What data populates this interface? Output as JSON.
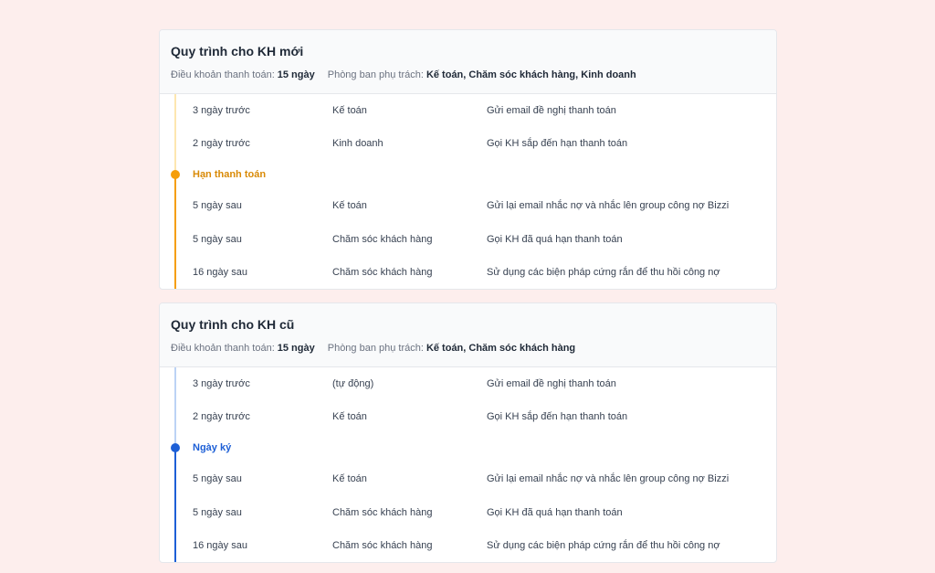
{
  "colors": {
    "background": "#fdeeed",
    "accent_orange": "#f59e0b",
    "accent_orange_light": "#fde7b0",
    "accent_blue": "#1d5fd6",
    "accent_blue_light": "#bcd3f5"
  },
  "cards": [
    {
      "title": "Quy trình cho KH mới",
      "terms_label": "Điều khoản thanh toán:",
      "terms_value": "15 ngày",
      "dept_label": "Phòng ban phụ trách:",
      "dept_value": "Kế toán, Chăm sóc khách hàng, Kinh doanh",
      "before": [
        {
          "time": "3 ngày trước",
          "dept": "Kế toán",
          "action": "Gửi email đề nghị thanh toán"
        },
        {
          "time": "2 ngày trước",
          "dept": "Kinh doanh",
          "action": "Gọi KH sắp đến hạn thanh toán"
        }
      ],
      "milestone": "Hạn thanh toán",
      "after": [
        {
          "time": "5 ngày sau",
          "dept": "Kế toán",
          "action": "Gửi lại email nhắc nợ và nhắc lên group công nợ Bizzi"
        },
        {
          "time": "5 ngày sau",
          "dept": "Chăm sóc khách hàng",
          "action": "Gọi KH đã quá hạn thanh toán"
        },
        {
          "time": "16 ngày sau",
          "dept": "Chăm sóc khách hàng",
          "action": "Sử dụng các biện pháp cứng rắn để thu hồi công nợ"
        }
      ]
    },
    {
      "title": "Quy trình cho KH cũ",
      "terms_label": "Điều khoản thanh toán:",
      "terms_value": "15 ngày",
      "dept_label": "Phòng ban phụ trách:",
      "dept_value": "Kế toán, Chăm sóc khách hàng",
      "before": [
        {
          "time": "3 ngày trước",
          "dept": "(tự động)",
          "action": "Gửi email đề nghị thanh toán"
        },
        {
          "time": "2 ngày trước",
          "dept": "Kế toán",
          "action": "Gọi KH sắp đến hạn thanh toán"
        }
      ],
      "milestone": "Ngày ký",
      "after": [
        {
          "time": "5 ngày sau",
          "dept": "Kế toán",
          "action": "Gửi lại email nhắc nợ và nhắc lên group công nợ Bizzi"
        },
        {
          "time": "5 ngày sau",
          "dept": "Chăm sóc khách hàng",
          "action": "Gọi KH đã quá hạn thanh toán"
        },
        {
          "time": "16 ngày sau",
          "dept": "Chăm sóc khách hàng",
          "action": "Sử dụng các biện pháp cứng rắn để thu hồi công nợ"
        }
      ]
    }
  ]
}
